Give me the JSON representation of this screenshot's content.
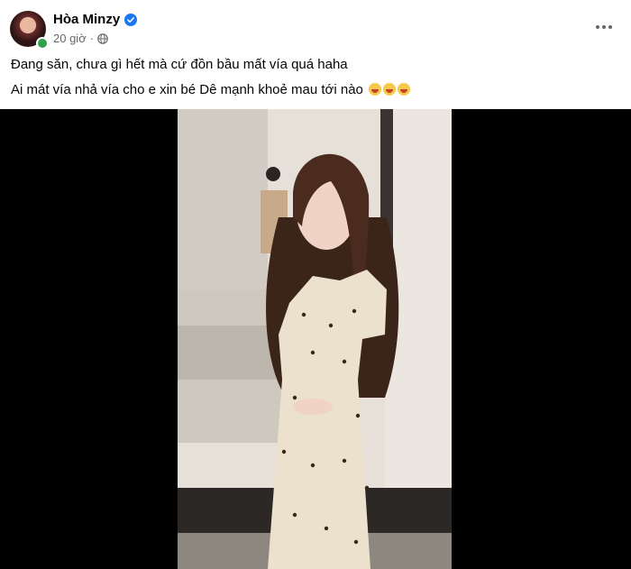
{
  "post": {
    "author": "Hòa Minzy",
    "time": "20 giờ",
    "separator": "·",
    "caption_line1": "Đang săn, chưa gì hết mà cứ đồn bầu mất vía quá haha",
    "caption_line2": "Ai mát vía nhả vía cho e xin bé Dê mạnh khoẻ mau tới nào"
  },
  "colors": {
    "verified": "#1877f2",
    "online": "#31a24c",
    "meta_text": "#65676b"
  },
  "icons": [
    "verified-badge-icon",
    "globe-icon",
    "more-options-icon",
    "laughing-emoji-icon"
  ]
}
